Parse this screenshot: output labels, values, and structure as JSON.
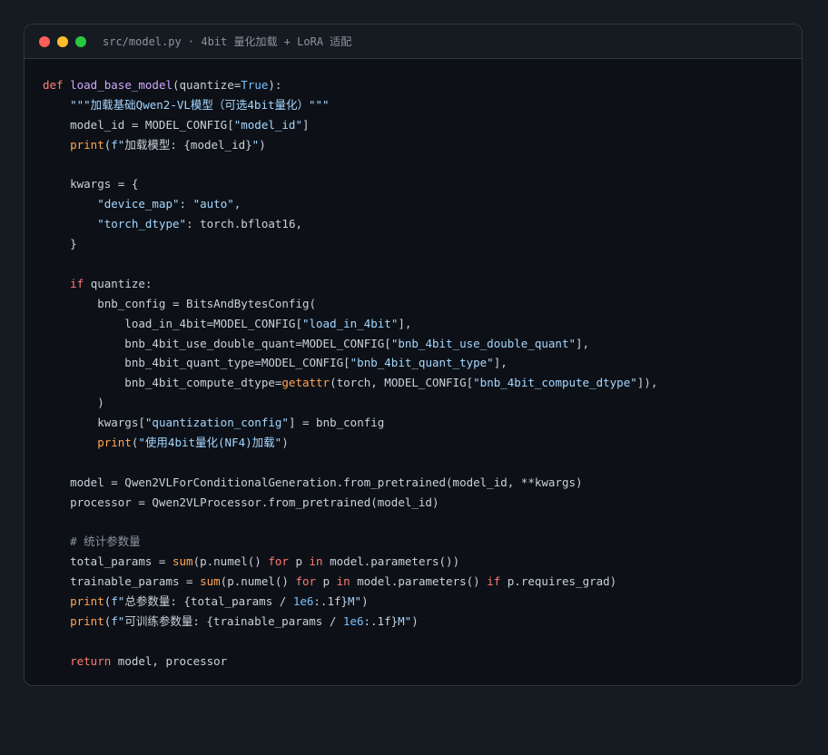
{
  "window": {
    "title": "src/model.py · 4bit 量化加载 + LoRA 适配"
  },
  "code": {
    "lines": [
      [
        [
          "kw",
          "def "
        ],
        [
          "fn",
          "load_base_model"
        ],
        [
          "tx",
          "(quantize="
        ],
        [
          "num",
          "True"
        ],
        [
          "tx",
          "):"
        ]
      ],
      [
        [
          "tx",
          "    "
        ],
        [
          "str",
          "\"\"\"加载基础Qwen2-VL模型（可选4bit量化）\"\"\""
        ]
      ],
      [
        [
          "tx",
          "    model_id = MODEL_CONFIG["
        ],
        [
          "str",
          "\"model_id\""
        ],
        [
          "tx",
          "]"
        ]
      ],
      [
        [
          "tx",
          "    "
        ],
        [
          "bi",
          "print"
        ],
        [
          "tx",
          "("
        ],
        [
          "str",
          "f\""
        ],
        [
          "tx",
          "加载模型: {model_id}"
        ],
        [
          "str",
          "\""
        ],
        [
          "tx",
          ")"
        ]
      ],
      [],
      [
        [
          "tx",
          "    kwargs = {"
        ]
      ],
      [
        [
          "tx",
          "        "
        ],
        [
          "str",
          "\"device_map\""
        ],
        [
          "tx",
          ": "
        ],
        [
          "str",
          "\"auto\""
        ],
        [
          "tx",
          ","
        ]
      ],
      [
        [
          "tx",
          "        "
        ],
        [
          "str",
          "\"torch_dtype\""
        ],
        [
          "tx",
          ": torch.bfloat16,"
        ]
      ],
      [
        [
          "tx",
          "    }"
        ]
      ],
      [],
      [
        [
          "tx",
          "    "
        ],
        [
          "kw",
          "if"
        ],
        [
          "tx",
          " quantize:"
        ]
      ],
      [
        [
          "tx",
          "        bnb_config = BitsAndBytesConfig("
        ]
      ],
      [
        [
          "tx",
          "            load_in_4bit=MODEL_CONFIG["
        ],
        [
          "str",
          "\"load_in_4bit\""
        ],
        [
          "tx",
          "],"
        ]
      ],
      [
        [
          "tx",
          "            bnb_4bit_use_double_quant=MODEL_CONFIG["
        ],
        [
          "str",
          "\"bnb_4bit_use_double_quant\""
        ],
        [
          "tx",
          "],"
        ]
      ],
      [
        [
          "tx",
          "            bnb_4bit_quant_type=MODEL_CONFIG["
        ],
        [
          "str",
          "\"bnb_4bit_quant_type\""
        ],
        [
          "tx",
          "],"
        ]
      ],
      [
        [
          "tx",
          "            bnb_4bit_compute_dtype="
        ],
        [
          "bi",
          "getattr"
        ],
        [
          "tx",
          "(torch, MODEL_CONFIG["
        ],
        [
          "str",
          "\"bnb_4bit_compute_dtype\""
        ],
        [
          "tx",
          "]),"
        ]
      ],
      [
        [
          "tx",
          "        )"
        ]
      ],
      [
        [
          "tx",
          "        kwargs["
        ],
        [
          "str",
          "\"quantization_config\""
        ],
        [
          "tx",
          "] = bnb_config"
        ]
      ],
      [
        [
          "tx",
          "        "
        ],
        [
          "bi",
          "print"
        ],
        [
          "tx",
          "("
        ],
        [
          "str",
          "\"使用4bit量化(NF4)加载\""
        ],
        [
          "tx",
          ")"
        ]
      ],
      [],
      [
        [
          "tx",
          "    model = Qwen2VLForConditionalGeneration.from_pretrained(model_id, **kwargs)"
        ]
      ],
      [
        [
          "tx",
          "    processor = Qwen2VLProcessor.from_pretrained(model_id)"
        ]
      ],
      [],
      [
        [
          "tx",
          "    "
        ],
        [
          "cm",
          "# 统计参数量"
        ]
      ],
      [
        [
          "tx",
          "    total_params = "
        ],
        [
          "bi",
          "sum"
        ],
        [
          "tx",
          "(p.numel() "
        ],
        [
          "kw",
          "for"
        ],
        [
          "tx",
          " p "
        ],
        [
          "kw",
          "in"
        ],
        [
          "tx",
          " model.parameters())"
        ]
      ],
      [
        [
          "tx",
          "    trainable_params = "
        ],
        [
          "bi",
          "sum"
        ],
        [
          "tx",
          "(p.numel() "
        ],
        [
          "kw",
          "for"
        ],
        [
          "tx",
          " p "
        ],
        [
          "kw",
          "in"
        ],
        [
          "tx",
          " model.parameters() "
        ],
        [
          "kw",
          "if"
        ],
        [
          "tx",
          " p.requires_grad)"
        ]
      ],
      [
        [
          "tx",
          "    "
        ],
        [
          "bi",
          "print"
        ],
        [
          "tx",
          "("
        ],
        [
          "str",
          "f\""
        ],
        [
          "tx",
          "总参数量: {total_params / "
        ],
        [
          "num",
          "1e6"
        ],
        [
          "tx",
          ":.1f}"
        ],
        [
          "str",
          "M\""
        ],
        [
          "tx",
          ")"
        ]
      ],
      [
        [
          "tx",
          "    "
        ],
        [
          "bi",
          "print"
        ],
        [
          "tx",
          "("
        ],
        [
          "str",
          "f\""
        ],
        [
          "tx",
          "可训练参数量: {trainable_params / "
        ],
        [
          "num",
          "1e6"
        ],
        [
          "tx",
          ":.1f}"
        ],
        [
          "str",
          "M\""
        ],
        [
          "tx",
          ")"
        ]
      ],
      [],
      [
        [
          "tx",
          "    "
        ],
        [
          "kw",
          "return"
        ],
        [
          "tx",
          " model, processor"
        ]
      ]
    ]
  }
}
